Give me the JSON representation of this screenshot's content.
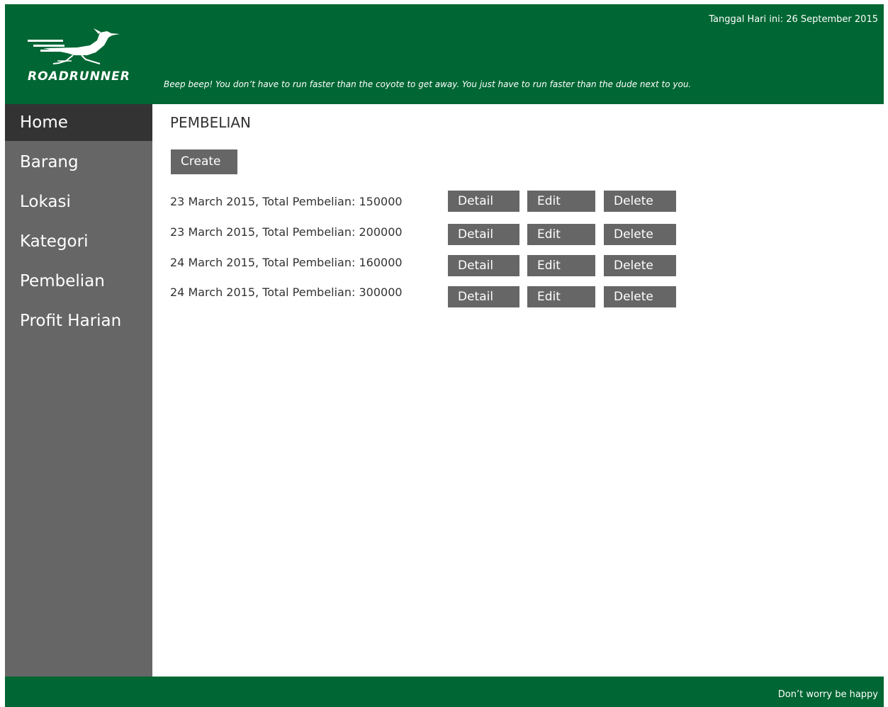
{
  "header": {
    "logo_text": "ROADRUNNER",
    "tagline": "Beep beep! You don’t have to run faster than the coyote to get away. You just have to run faster than the dude next to you.",
    "date_today": "Tanggal Hari ini: 26 September 2015",
    "logo_icon": "roadrunner-bird-icon"
  },
  "sidebar": {
    "items": [
      {
        "label": "Home",
        "active": true
      },
      {
        "label": "Barang",
        "active": false
      },
      {
        "label": "Lokasi",
        "active": false
      },
      {
        "label": "Kategori",
        "active": false
      },
      {
        "label": "Pembelian",
        "active": false
      },
      {
        "label": "Profit Harian",
        "active": false
      }
    ]
  },
  "main": {
    "title": "PEMBELIAN",
    "create_label": "Create",
    "rows": [
      {
        "text": "23 March 2015, Total Pembelian: 150000",
        "detail": "Detail",
        "edit": "Edit",
        "delete": "Delete"
      },
      {
        "text": "23 March 2015, Total Pembelian: 200000",
        "detail": "Detail",
        "edit": "Edit",
        "delete": "Delete"
      },
      {
        "text": "24 March 2015, Total Pembelian: 160000",
        "detail": "Detail",
        "edit": "Edit",
        "delete": "Delete"
      },
      {
        "text": "24 March 2015, Total Pembelian: 300000",
        "detail": "Detail",
        "edit": "Edit",
        "delete": "Delete"
      }
    ]
  },
  "footer": {
    "text": "Don’t worry be happy"
  },
  "colors": {
    "brand_green": "#006633",
    "sidebar_gray": "#666666",
    "active_dark": "#333333",
    "button_gray": "#666666"
  }
}
